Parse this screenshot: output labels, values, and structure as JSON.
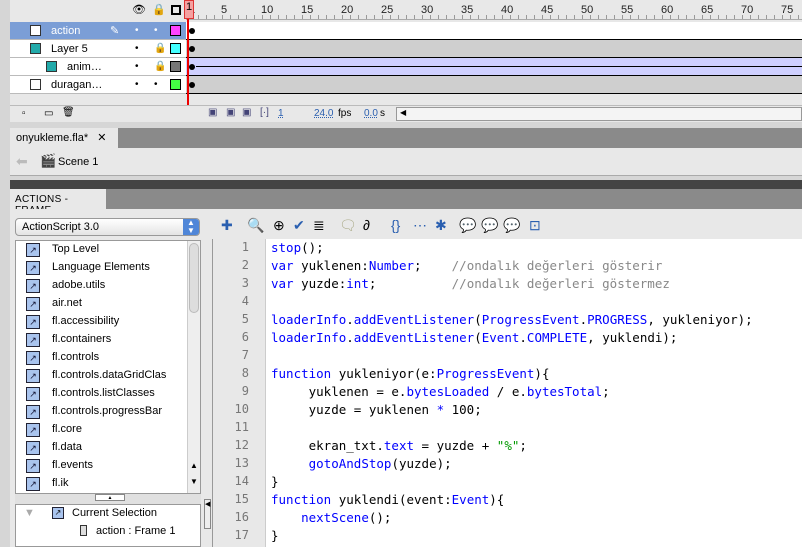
{
  "timeline": {
    "ruler_ticks": [
      "1",
      "5",
      "10",
      "15",
      "20",
      "25",
      "30",
      "35",
      "40",
      "45",
      "50",
      "55",
      "60",
      "65",
      "70",
      "75"
    ],
    "layers": [
      {
        "name": "action",
        "color": "#ff44ff",
        "selected": true,
        "locked": false,
        "icon": "layer-icon",
        "edit": true
      },
      {
        "name": "Layer 5",
        "color": "#44ffff",
        "selected": false,
        "locked": true,
        "icon": "mask-layer-icon"
      },
      {
        "name": "anim…",
        "color": "#777777",
        "selected": false,
        "locked": true,
        "icon": "masked-layer-icon",
        "tween": true
      },
      {
        "name": "duragan…",
        "color": "#44ff44",
        "selected": false,
        "locked": false,
        "icon": "layer-icon"
      }
    ],
    "current_frame": "1",
    "fps": "24.0",
    "fps_unit": "fps",
    "time": "0.0",
    "time_unit": "s"
  },
  "document_tab": "onyukleme.fla*",
  "scene": "Scene 1",
  "actions": {
    "title": "ACTIONS - FRAME",
    "language": "ActionScript 3.0",
    "tree": [
      "Top Level",
      "Language Elements",
      "adobe.utils",
      "air.net",
      "fl.accessibility",
      "fl.containers",
      "fl.controls",
      "fl.controls.dataGridClas",
      "fl.controls.listClasses",
      "fl.controls.progressBar",
      "fl.core",
      "fl.data",
      "fl.events",
      "fl.ik"
    ],
    "current_selection": "Current Selection",
    "selection_item": "action : Frame 1",
    "code": [
      [
        [
          "k",
          "stop"
        ],
        [
          "",
          "();"
        ]
      ],
      [
        [
          "k",
          "var"
        ],
        [
          "",
          " yuklenen:"
        ],
        [
          "k",
          "Number"
        ],
        [
          "",
          ";    "
        ],
        [
          "c",
          "//ondalık değerleri gösterir"
        ]
      ],
      [
        [
          "k",
          "var"
        ],
        [
          "",
          " yuzde:"
        ],
        [
          "k",
          "int"
        ],
        [
          "",
          ";          "
        ],
        [
          "c",
          "//ondalık değerleri göstermez"
        ]
      ],
      [],
      [
        [
          "k",
          "loaderInfo"
        ],
        [
          "",
          "."
        ],
        [
          "k",
          "addEventListener"
        ],
        [
          "",
          "("
        ],
        [
          "k",
          "ProgressEvent"
        ],
        [
          "",
          "."
        ],
        [
          "k",
          "PROGRESS"
        ],
        [
          "",
          ", yukleniyor);"
        ]
      ],
      [
        [
          "k",
          "loaderInfo"
        ],
        [
          "",
          "."
        ],
        [
          "k",
          "addEventListener"
        ],
        [
          "",
          "("
        ],
        [
          "k",
          "Event"
        ],
        [
          "",
          "."
        ],
        [
          "k",
          "COMPLETE"
        ],
        [
          "",
          ", yuklendi);"
        ]
      ],
      [],
      [
        [
          "k",
          "function"
        ],
        [
          "",
          " yukleniyor(e:"
        ],
        [
          "k",
          "ProgressEvent"
        ],
        [
          "",
          "){"
        ]
      ],
      [
        [
          "",
          "     yuklenen = e."
        ],
        [
          "k",
          "bytesLoaded"
        ],
        [
          "",
          " / e."
        ],
        [
          "k",
          "bytesTotal"
        ],
        [
          "",
          ";"
        ]
      ],
      [
        [
          "",
          "     yuzde = yuklenen "
        ],
        [
          "k",
          "*"
        ],
        [
          "",
          " 100;"
        ]
      ],
      [],
      [
        [
          "",
          "     ekran_txt."
        ],
        [
          "k",
          "text"
        ],
        [
          "",
          " = yuzde + "
        ],
        [
          "s",
          "\"%\""
        ],
        [
          "",
          ";"
        ]
      ],
      [
        [
          "",
          "     "
        ],
        [
          "k",
          "gotoAndStop"
        ],
        [
          "",
          "(yuzde);"
        ]
      ],
      [
        [
          "",
          "}"
        ]
      ],
      [
        [
          "k",
          "function"
        ],
        [
          "",
          " yuklendi(event:"
        ],
        [
          "k",
          "Event"
        ],
        [
          "",
          "){"
        ]
      ],
      [
        [
          "",
          "    "
        ],
        [
          "k",
          "nextScene"
        ],
        [
          "",
          "();"
        ]
      ],
      [
        [
          "",
          "}"
        ]
      ]
    ]
  }
}
